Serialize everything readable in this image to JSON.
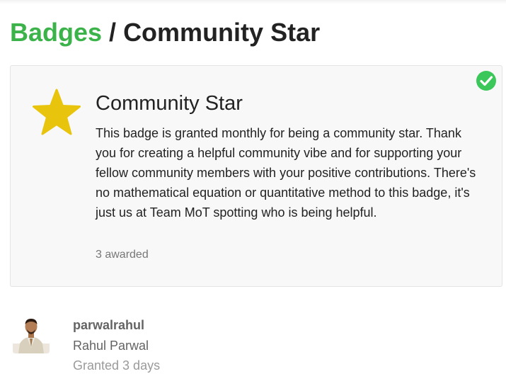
{
  "breadcrumb": {
    "parent": "Badges",
    "separator": " / ",
    "current": "Community Star"
  },
  "badge": {
    "icon": "star-icon",
    "icon_color": "#e8c40c",
    "title": "Community Star",
    "description": "This badge is granted monthly for being a community star. Thank you for creating a helpful community vibe and for supporting your fellow community members with your positive contributions. There's no mathematical equation or quantitative method to this badge, it's just us at Team MoT spotting who is being helpful.",
    "awarded_count": "3 awarded",
    "granted_indicator": "check-circle-icon",
    "granted_color": "#3cc75a"
  },
  "awards": [
    {
      "username": "parwalrahul",
      "full_name": "Rahul Parwal",
      "granted": "Granted 3 days"
    }
  ],
  "colors": {
    "accent_green": "#3cb34a",
    "text_dark": "#222222",
    "text_muted": "#777777"
  }
}
